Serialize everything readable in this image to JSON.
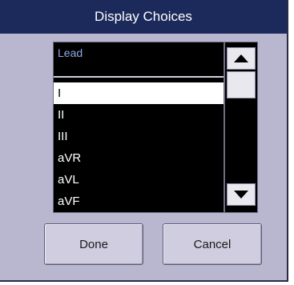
{
  "dialog": {
    "title": "Display Choices"
  },
  "list": {
    "header": "Lead",
    "items": [
      "I",
      "II",
      "III",
      "aVR",
      "aVL",
      "aVF"
    ],
    "selected_index": 0
  },
  "scrollbar": {
    "up_icon": "triangle-up-icon",
    "down_icon": "triangle-down-icon"
  },
  "buttons": {
    "done_label": "Done",
    "cancel_label": "Cancel"
  },
  "colors": {
    "title_bar": "#1b2a5a",
    "dialog_bg": "#b9b7cf",
    "list_bg": "#000000",
    "header_text": "#8fa6e8",
    "selected_bg": "#ffffff"
  }
}
